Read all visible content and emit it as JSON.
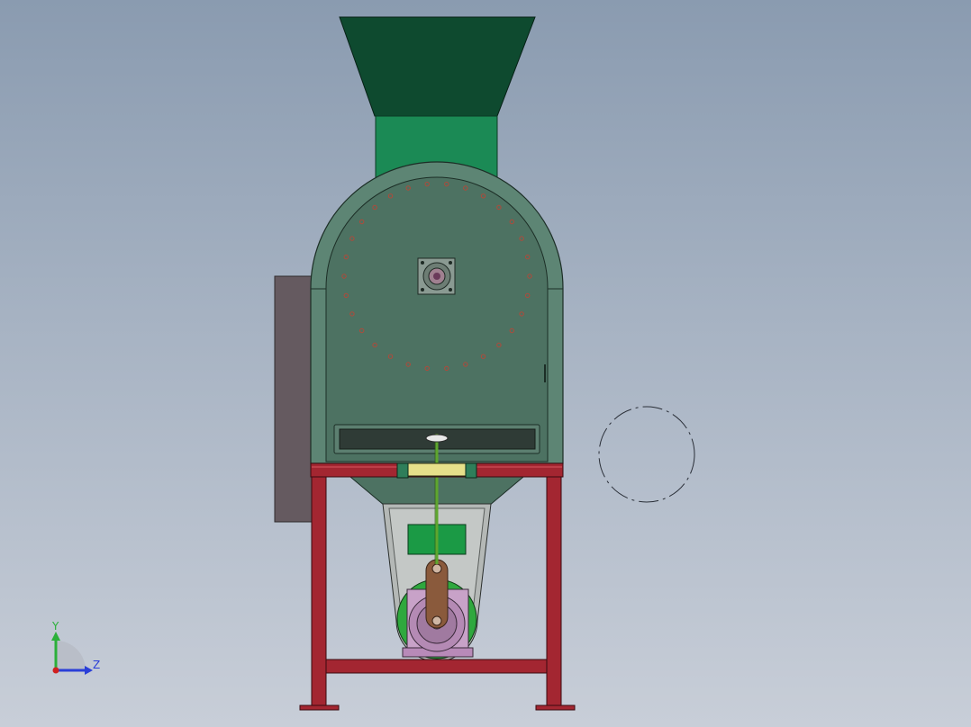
{
  "viewport": {
    "background_top": "#8a9bb0",
    "background_bottom": "#c8ced8"
  },
  "model": {
    "hopper_color": "#0e4a2f",
    "neck_color": "#1b8a55",
    "body_color": "#4d7262",
    "frame_color": "#a32631",
    "panel_color": "#655a60",
    "motor_color": "#c8a2c8",
    "arm_color": "#8a5a3c",
    "rod_color": "#5ea62e",
    "bolt_hole_color": "#b04a3a"
  },
  "triad": {
    "y_label": "Y",
    "z_label": "Z",
    "y_color": "#2bb03a",
    "z_color": "#2a3fd8",
    "origin_color": "#d02020"
  },
  "reference_circle": {
    "visible": true
  }
}
